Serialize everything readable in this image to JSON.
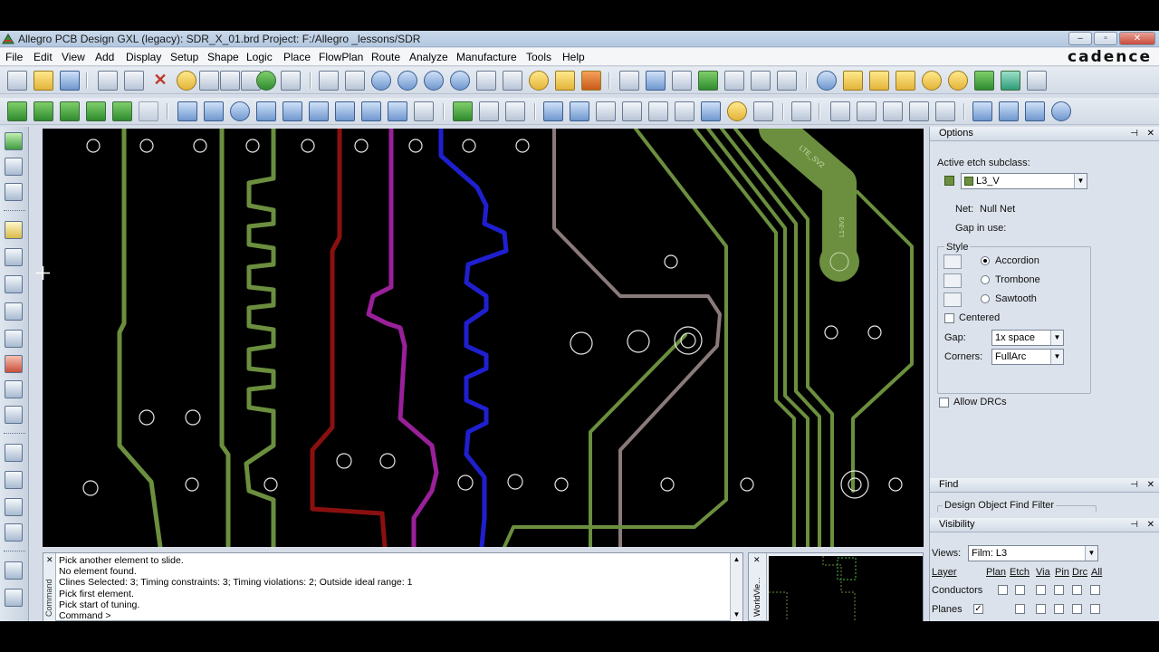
{
  "window": {
    "title": "Allegro PCB Design GXL (legacy): SDR_X_01.brd  Project: F:/Allegro _lessons/SDR",
    "brand": "cadence",
    "buttons": {
      "minimize": "–",
      "maximize": "▫",
      "close": "✕"
    }
  },
  "menu": [
    "File",
    "Edit",
    "View",
    "Add",
    "Display",
    "Setup",
    "Shape",
    "Logic",
    "Place",
    "FlowPlan",
    "Route",
    "Analyze",
    "Manufacture",
    "Tools",
    "Help"
  ],
  "canvas": {
    "background": "#000000",
    "trace_colors": {
      "olive": "#6b8f3e",
      "red": "#8a1010",
      "magenta": "#9a209a",
      "blue": "#1f1fd0",
      "mauve": "#8a7a7a"
    },
    "labels": [
      "LTE_SV2",
      "L1-3V3"
    ]
  },
  "console": {
    "label": "Command",
    "lines": [
      "Pick another element to slide.",
      "No element found.",
      "Clines Selected: 3; Timing constraints: 3; Timing violations: 2; Outside ideal range: 1",
      "Pick first element.",
      "Pick start of tuning.",
      "Command >"
    ]
  },
  "worldview": {
    "label": "WorldVie..."
  },
  "options": {
    "title": "Options",
    "active_label": "Active etch subclass:",
    "active_value": "L3_V",
    "net_label": "Net:",
    "net_value": "Null Net",
    "gap_in_use_label": "Gap in use:",
    "style_label": "Style",
    "styles": [
      "Accordion",
      "Trombone",
      "Sawtooth"
    ],
    "centered_label": "Centered",
    "gap_label": "Gap:",
    "gap_value": "1x space",
    "corners_label": "Corners:",
    "corners_value": "FullArc",
    "allow_drcs_label": "Allow DRCs"
  },
  "find": {
    "title": "Find",
    "filter_label": "Design Object Find Filter"
  },
  "visibility": {
    "title": "Visibility",
    "views_label": "Views:",
    "views_value": "Film: L3",
    "columns": [
      "Layer",
      "Plan",
      "Etch",
      "Via",
      "Pin",
      "Drc",
      "All"
    ],
    "rows": [
      "Conductors",
      "Planes"
    ]
  }
}
